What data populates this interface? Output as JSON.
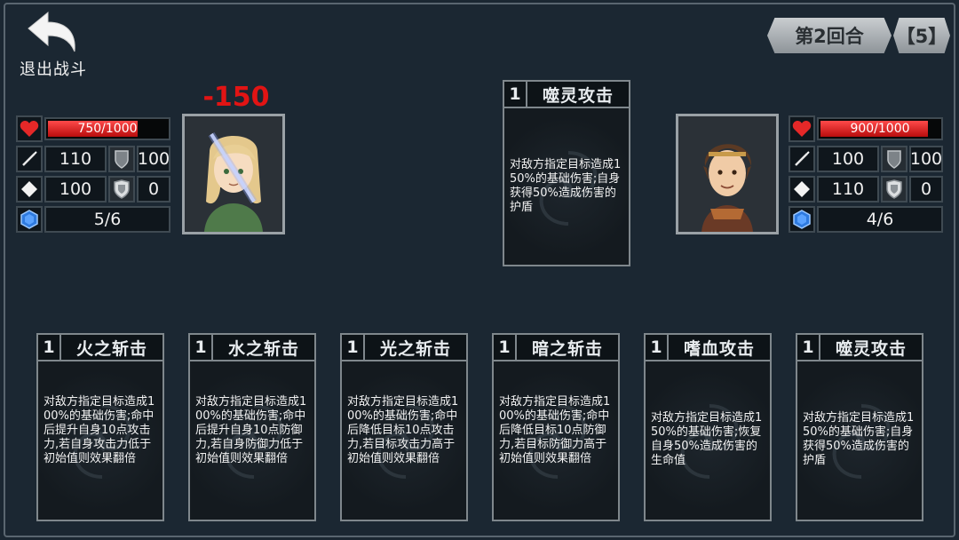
{
  "exit": {
    "label": "退出战斗"
  },
  "header": {
    "round": "第2回合",
    "turns": "【5】"
  },
  "damage_popup": "-150",
  "player": {
    "hp": {
      "text": "750/1000",
      "fraction": 0.75
    },
    "attack": "110",
    "defense": "100",
    "crit": "100",
    "resist": "0",
    "energy": "5/6"
  },
  "enemy": {
    "hp": {
      "text": "900/1000",
      "fraction": 0.9
    },
    "attack": "100",
    "defense": "100",
    "crit": "110",
    "resist": "0",
    "energy": "4/6"
  },
  "enemy_skill": {
    "cost": "1",
    "name": "噬灵攻击",
    "desc": "对敌方指定目标造成150%的基础伤害;自身获得50%造成伤害的护盾"
  },
  "skills": [
    {
      "cost": "1",
      "name": "火之斩击",
      "desc": "对敌方指定目标造成100%的基础伤害;命中后提升自身10点攻击力,若自身攻击力低于初始值则效果翻倍"
    },
    {
      "cost": "1",
      "name": "水之斩击",
      "desc": "对敌方指定目标造成100%的基础伤害;命中后提升自身10点防御力,若自身防御力低于初始值则效果翻倍"
    },
    {
      "cost": "1",
      "name": "光之斩击",
      "desc": "对敌方指定目标造成100%的基础伤害;命中后降低目标10点攻击力,若目标攻击力高于初始值则效果翻倍"
    },
    {
      "cost": "1",
      "name": "暗之斩击",
      "desc": "对敌方指定目标造成100%的基础伤害;命中后降低目标10点防御力,若目标防御力高于初始值则效果翻倍"
    },
    {
      "cost": "1",
      "name": "嗜血攻击",
      "desc": "对敌方指定目标造成150%的基础伤害;恢复自身50%造成伤害的生命值"
    },
    {
      "cost": "1",
      "name": "噬灵攻击",
      "desc": "对敌方指定目标造成150%的基础伤害;自身获得50%造成伤害的护盾"
    }
  ],
  "icons": {
    "hp": "heart-icon",
    "attack": "sword-icon",
    "defense": "shield-icon",
    "crit": "diamond-icon",
    "resist": "emblem-shield-icon",
    "energy": "crystal-icon",
    "exit": "back-arrow-icon"
  },
  "colors": {
    "hp_fill": "#d42020",
    "damage": "#e11414",
    "background": "#1b2732"
  }
}
